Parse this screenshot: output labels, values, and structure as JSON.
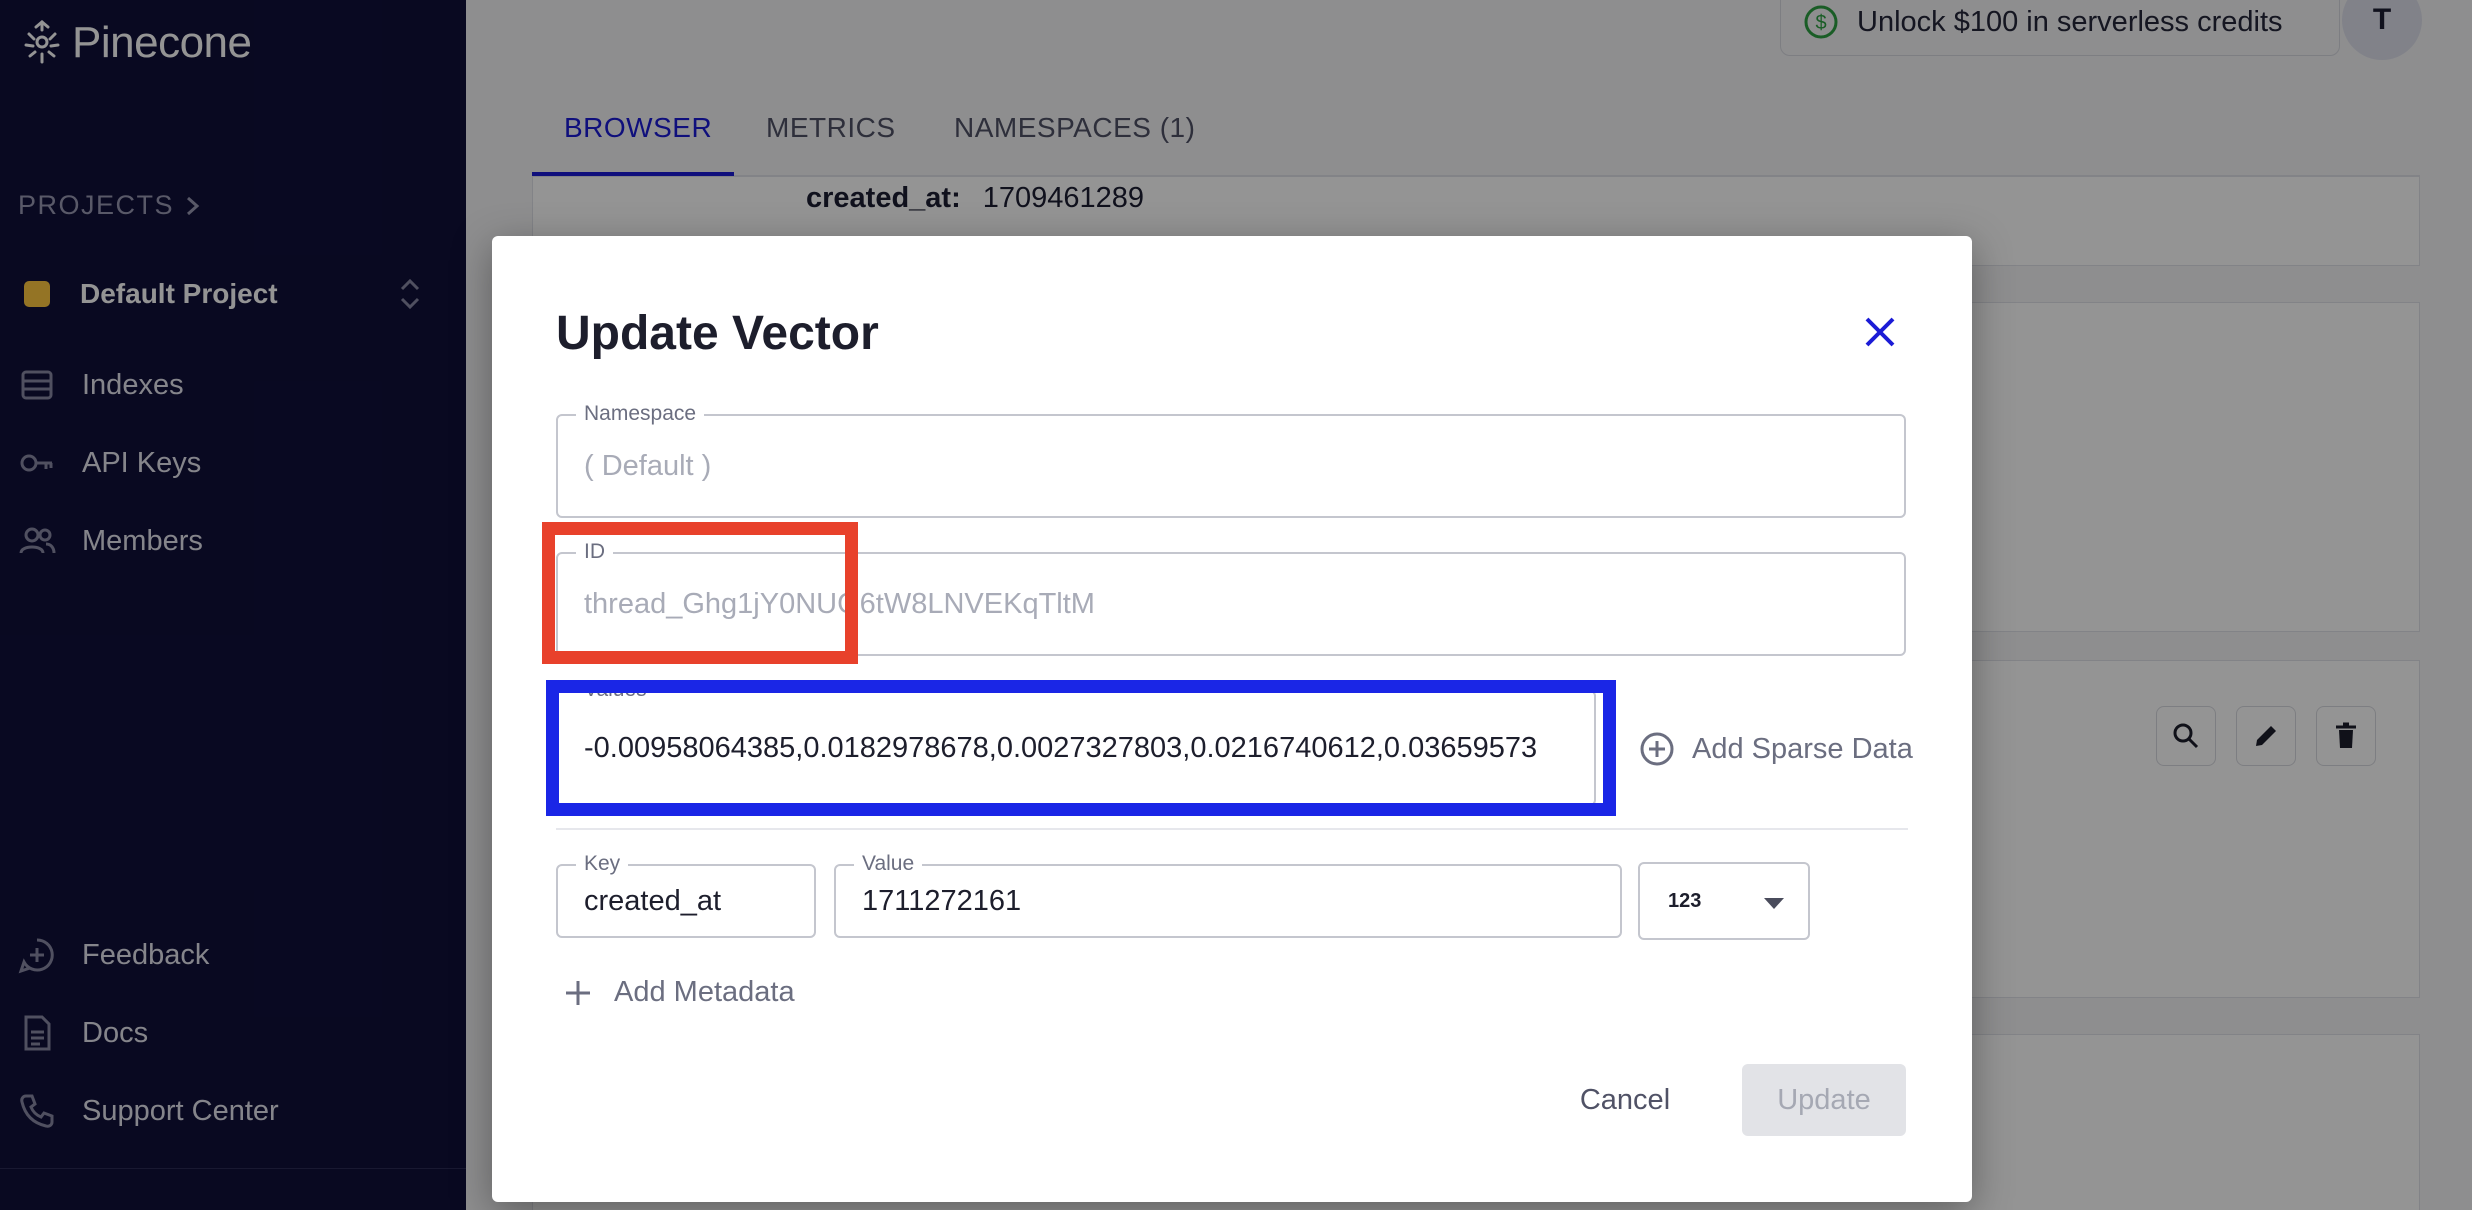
{
  "sidebar": {
    "brand": "Pinecone",
    "projects_label": "PROJECTS",
    "project_name": "Default Project",
    "nav": [
      {
        "label": "Indexes",
        "icon": "indexes-icon"
      },
      {
        "label": "API Keys",
        "icon": "key-icon"
      },
      {
        "label": "Members",
        "icon": "members-icon"
      }
    ],
    "bottom": [
      {
        "label": "Feedback",
        "icon": "feedback-icon"
      },
      {
        "label": "Docs",
        "icon": "docs-icon"
      },
      {
        "label": "Support Center",
        "icon": "phone-icon"
      }
    ]
  },
  "header": {
    "credits_label": "Unlock $100 in serverless credits",
    "avatar_initial": "T"
  },
  "tabs": [
    {
      "label": "BROWSER",
      "active": true
    },
    {
      "label": "METRICS",
      "active": false
    },
    {
      "label": "NAMESPACES (1)",
      "active": false
    }
  ],
  "background_record": {
    "key": "created_at:",
    "value": "1709461289"
  },
  "modal": {
    "title": "Update Vector",
    "namespace": {
      "label": "Namespace",
      "value": "( Default )"
    },
    "id": {
      "label": "ID",
      "value": "thread_Ghg1jY0NUG6tW8LNVEKqTltM"
    },
    "values": {
      "label": "Values",
      "value": "-0.00958064385,0.0182978678,0.0027327803,0.0216740612,0.03659573"
    },
    "add_sparse_label": "Add Sparse Data",
    "metadata": {
      "key_label": "Key",
      "key_value": "created_at",
      "value_label": "Value",
      "value_value": "1711272161",
      "type": "123"
    },
    "add_metadata_label": "Add Metadata",
    "cancel_label": "Cancel",
    "update_label": "Update"
  },
  "colors": {
    "sidebar_bg": "#10103a",
    "accent": "#1b1bd6",
    "highlight_red": "#e8412b",
    "highlight_blue": "#1a26e6"
  }
}
